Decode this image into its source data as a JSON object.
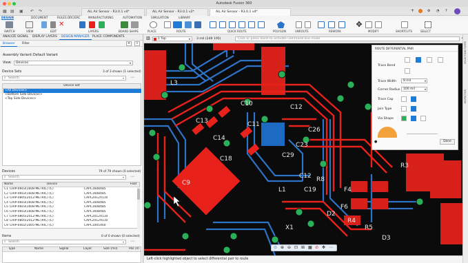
{
  "window": {
    "title": "Autodesk Fusion 360"
  },
  "doc_tabs": [
    "AiL Air Sensor - R3.0.1 v4*",
    "AiL Air Sensor - R3.0.1 v2*",
    "AiL Air Sensor - R3.0.1 v4*"
  ],
  "ribbon_tabs": [
    "DESIGN",
    "DOCUMENT",
    "RULES DRC/ERC",
    "MANUFACTURING",
    "AUTOMATION",
    "SIMULATION",
    "LIBRARY"
  ],
  "ribbon_groups": [
    "SWITCH",
    "VIEW",
    "EDIT",
    "LAYERS",
    "BOARD SHAPE",
    "PLACE",
    "ROUTE",
    "QUICK ROUTE",
    "POLYGON",
    "UNROUTE",
    "REWORK",
    "MODIFY",
    "SHORTCUTS",
    "SELECT"
  ],
  "panel_tabs": [
    "ANALYZE SIGNAL",
    "DISPLAY LAYERS",
    "DESIGN MANAGER",
    "PLACE COMPONENTS"
  ],
  "sub_tabs": [
    "Browser",
    "Filter"
  ],
  "assembly": {
    "label": "Assembly Variant:",
    "value": "Default Variant"
  },
  "view": {
    "label": "View:",
    "value": "Devices"
  },
  "device_sets": {
    "title": "Device Sets",
    "count": "3 of 3 shown (1 selected)",
    "search_placeholder": "Search",
    "column": "Device Set",
    "rows": [
      "<All Devices>",
      "<Bottom Side Devices>",
      "<Top Side Devices>"
    ]
  },
  "devices": {
    "title": "Devices",
    "count": "79 of 79 shown (0 selected)",
    "search_placeholder": "Search",
    "columns": [
      "Name",
      "Device",
      "Foot"
    ],
    "rows": [
      {
        "name": "C1",
        "device": "CHIP-0603(1608-METRIC) (C)",
        "foot": "CAPC1608X85"
      },
      {
        "name": "C2",
        "device": "CHIP-0603(1608-METRIC) (C)",
        "foot": "CAPC1608X85"
      },
      {
        "name": "C3",
        "device": "CHIP-0805(2012-METRIC) (C)",
        "foot": "CAPC2012X110"
      },
      {
        "name": "C4",
        "device": "CHIP-0603(1608-METRIC) (C)",
        "foot": "CAPC1608X85"
      },
      {
        "name": "C5",
        "device": "CHIP-0603(1608-METRIC) (C)",
        "foot": "CAPC1608X85"
      },
      {
        "name": "C6",
        "device": "CHIP-0603(1608-METRIC) (C)",
        "foot": "CAPC1608X85"
      },
      {
        "name": "C7",
        "device": "CHIP-0805(2012-METRIC) (C)",
        "foot": "CAPC2012X110"
      },
      {
        "name": "C8",
        "device": "CHIP-0805(2012-METRIC) (C)",
        "foot": "CAPC2012X110"
      },
      {
        "name": "C9",
        "device": "CHIP-0402(1005-METRIC) (C)",
        "foot": "CAPC1005X60"
      }
    ]
  },
  "items": {
    "title": "Items",
    "count": "0 of 0 shown (0 selected)",
    "search_placeholder": "Search",
    "columns": [
      "Type",
      "Name",
      "Signal",
      "Layer",
      "Size (mil)",
      "Pos (m"
    ]
  },
  "canvas": {
    "layer": "1 Top",
    "coords": "3 mil (249 195)",
    "command_placeholder": "Click or press Slash to activate command line mode",
    "status": "Left-click highlighted object to select differential pair to route",
    "silk_labels": [
      "L3",
      "C13",
      "C14",
      "C18",
      "C10",
      "C11",
      "C12",
      "C26",
      "C23",
      "C29",
      "C12",
      "C19",
      "L1",
      "X1",
      "R8",
      "D2",
      "D3",
      "F6",
      "R4",
      "R5",
      "C9",
      "R3",
      "F4"
    ]
  },
  "diff_panel": {
    "title": "ROUTE DIFFERENTIAL PAIR",
    "trace_bend": "Trace Bend",
    "trace_width_label": "Trace Width",
    "trace_width_value": "8 mil",
    "corner_radius_label": "Corner Radius",
    "corner_radius_value": "100 mil",
    "trace_cap": "Trace Cap",
    "join_type": "Join Type",
    "via_shape": "Via Shape",
    "done": "Done"
  },
  "right_sidebar": [
    "INSPECTOR",
    "SELECTION FILTER"
  ],
  "colors": {
    "accent": "#1e7cd9",
    "top_copper": "#e8221b",
    "bottom_copper": "#2d73c8",
    "pad": "#2bb05a",
    "board": "#0b0b0b"
  }
}
